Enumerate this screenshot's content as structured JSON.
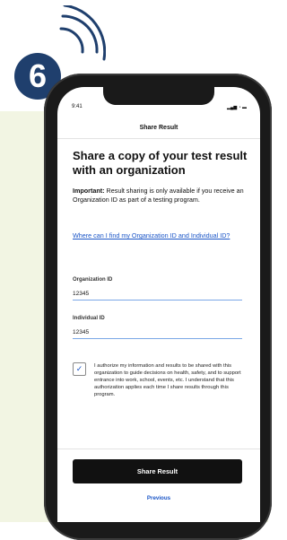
{
  "step": {
    "number": "6"
  },
  "status_bar": {
    "time": "9:41",
    "icons": "▂▄▆ ◔ ▬"
  },
  "nav": {
    "title": "Share Result"
  },
  "content": {
    "heading": "Share a copy of your test result with an organization",
    "important_label": "Important:",
    "important_text": "Result sharing is only available if you receive an Organization ID as part of a testing program.",
    "help_link": "Where can I find my Organization ID and Individual ID?"
  },
  "fields": {
    "organization_id": {
      "label": "Organization ID",
      "value": "12345"
    },
    "individual_id": {
      "label": "Individual ID",
      "value": "12345"
    }
  },
  "consent": {
    "checked": true,
    "check_mark": "✓",
    "text": "I authorize my information and results to be shared with this organization to guide decisions on health, safety, and to support entrance into work, school, events, etc. I understand that this authorization applies each time I share results through this program."
  },
  "actions": {
    "share_button": "Share Result",
    "previous": "Previous"
  },
  "colors": {
    "badge": "#1f3f6d",
    "link": "#1a55c7",
    "button": "#111111",
    "background_panel": "#f2f5e3"
  }
}
